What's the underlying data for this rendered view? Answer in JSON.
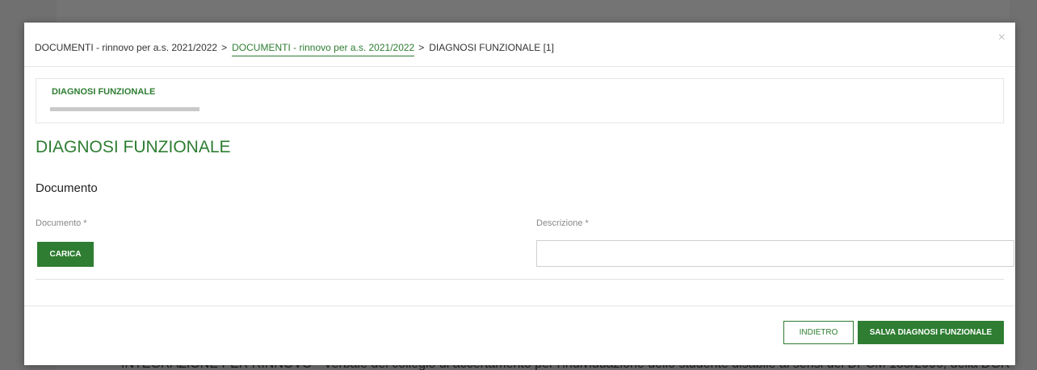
{
  "background": {
    "partial_text": "INTEGRAZIONE PER RINNOVO - Verbale del collegio di accertamento per l'individuazione dello studente disabile ai sensi del DPCM 185/2006, della DGR"
  },
  "modal": {
    "breadcrumb": {
      "item1": "DOCUMENTI - rinnovo per a.s. 2021/2022",
      "separator": ">",
      "item2": "DOCUMENTI - rinnovo per a.s. 2021/2022",
      "current": "DIAGNOSI FUNZIONALE [1]"
    },
    "close_label": "×",
    "steps": {
      "label": "DIAGNOSI FUNZIONALE"
    },
    "title": "DIAGNOSI FUNZIONALE",
    "section_title": "Documento",
    "form": {
      "document_label": "Documento *",
      "upload_button": "CARICA",
      "description_label": "Descrizione *",
      "description_value": ""
    },
    "footer": {
      "back_button": "INDIETRO",
      "save_button": "SALVA DIAGNOSI FUNZIONALE"
    }
  },
  "colors": {
    "accent": "#2e7d32",
    "overlay": "#707070"
  }
}
